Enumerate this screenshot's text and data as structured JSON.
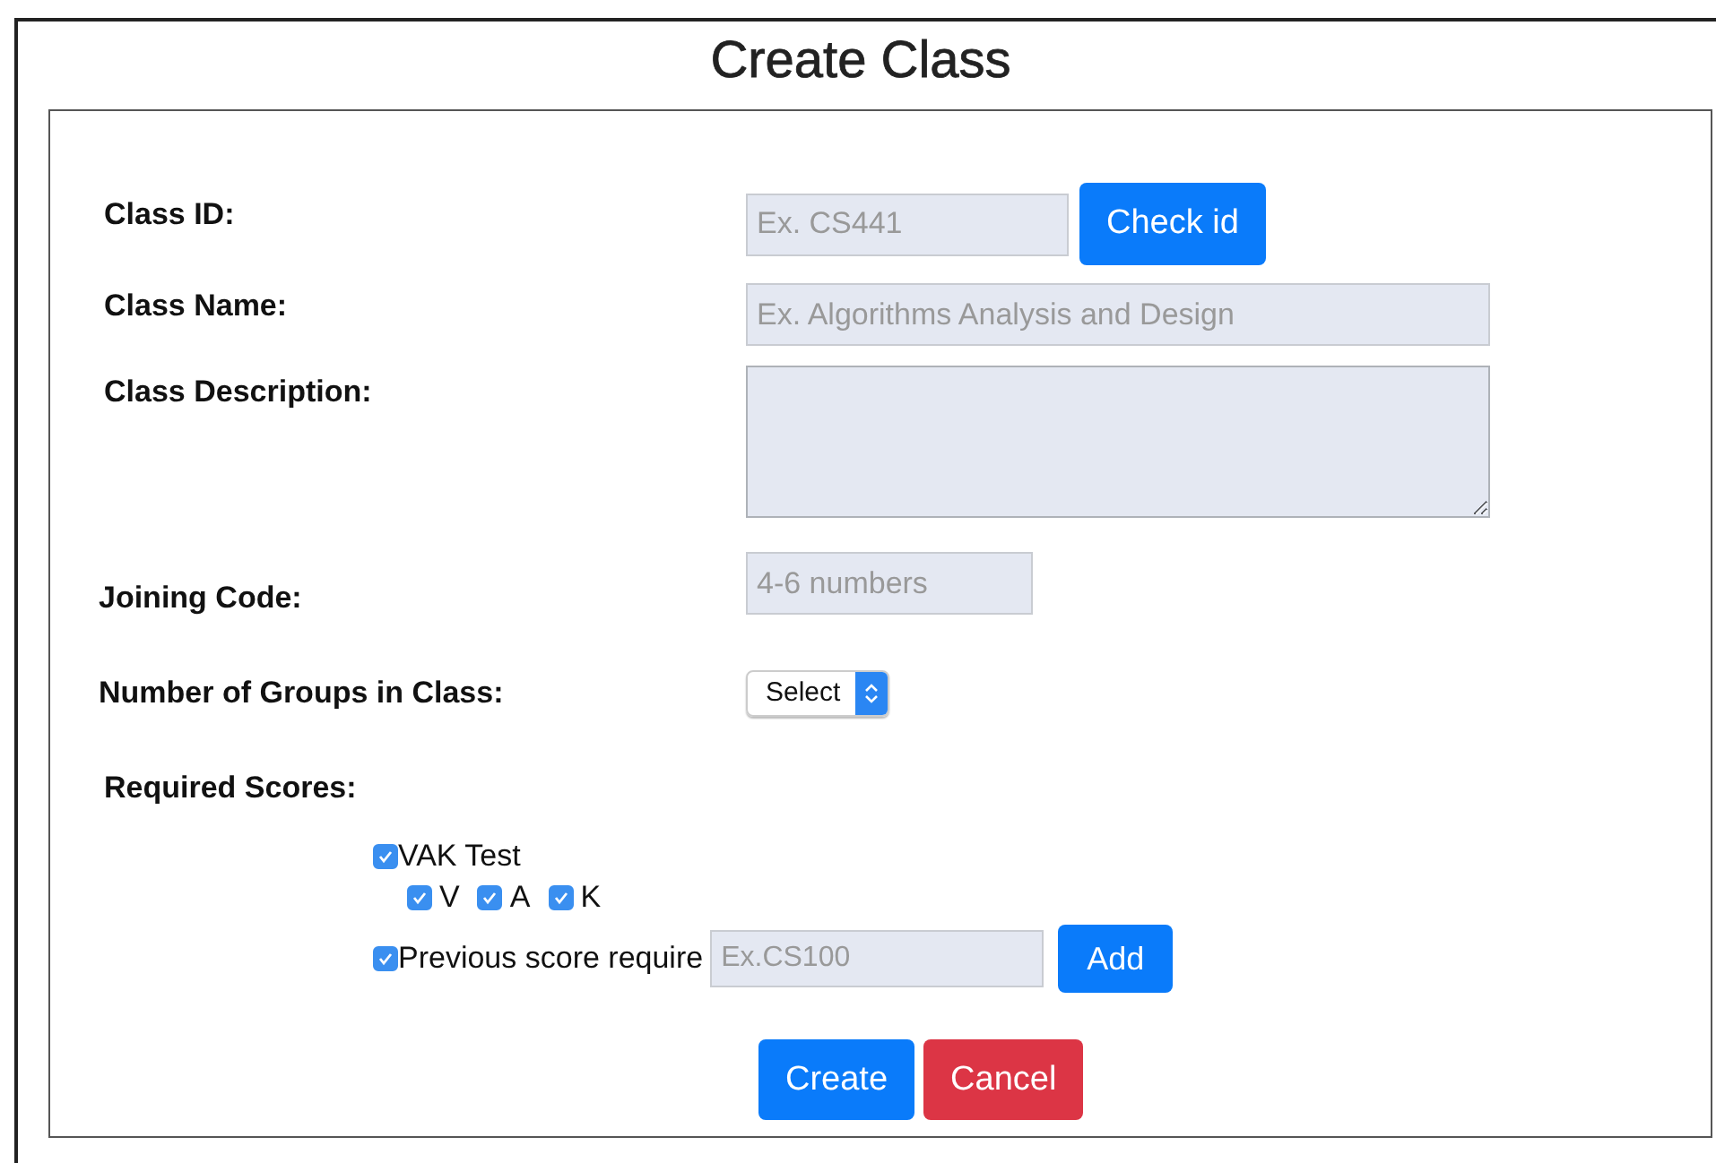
{
  "title": "Create Class",
  "fields": [
    {
      "label": "Class ID:",
      "kind": "input",
      "placeholder": "Ex. CS441",
      "button": "Check id"
    },
    {
      "label": "Class Name:",
      "kind": "input",
      "placeholder": "Ex. Algorithms Analysis and Design"
    },
    {
      "label": "Class Description:",
      "kind": "textarea"
    },
    {
      "label": "Joining Code:",
      "kind": "input",
      "placeholder": "4-6 numbers"
    },
    {
      "label": "Number of Groups in Class:",
      "kind": "select",
      "value": "Select"
    }
  ],
  "required_scores": {
    "label": "Required Scores:",
    "vak": {
      "label": "VAK Test",
      "checked": true,
      "options": [
        {
          "label": "V",
          "checked": true
        },
        {
          "label": "A",
          "checked": true
        },
        {
          "label": "K",
          "checked": true
        }
      ]
    },
    "previous": {
      "label": "Previous score require",
      "checked": true,
      "placeholder": "Ex.CS100",
      "button": "Add"
    }
  },
  "buttons": [
    {
      "label": "Create",
      "kind": "primary"
    },
    {
      "label": "Cancel",
      "kind": "danger"
    }
  ]
}
